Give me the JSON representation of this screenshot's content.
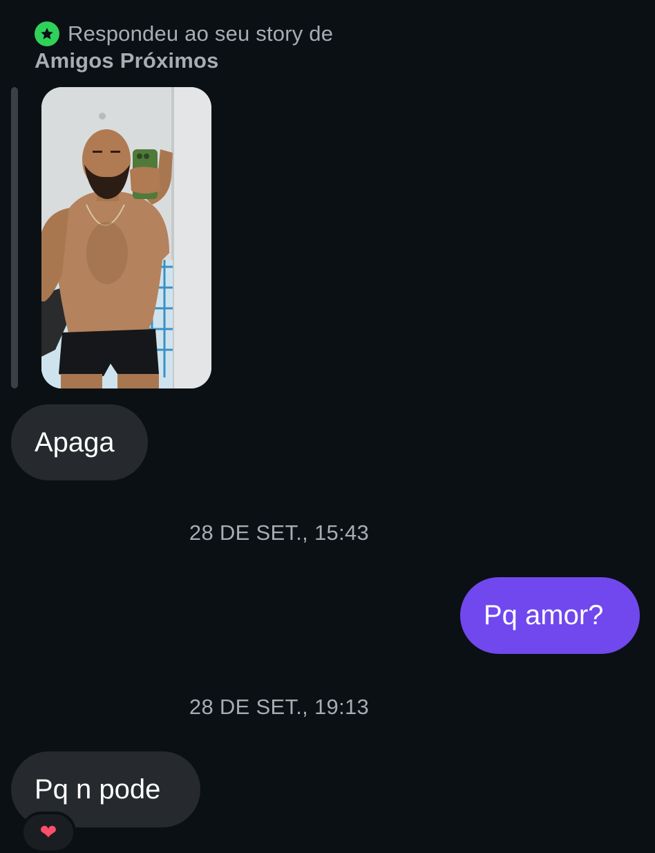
{
  "story_reply": {
    "label": "Respondeu ao seu story de",
    "list_name": "Amigos Próximos",
    "badge_icon": "close-friends-star-icon",
    "badge_color": "#2fd15a"
  },
  "messages": [
    {
      "direction": "incoming",
      "text": "Apaga"
    },
    {
      "direction": "outgoing",
      "text": "Pq amor?"
    },
    {
      "direction": "incoming",
      "text": "Pq n pode",
      "reaction": "❤"
    }
  ],
  "timestamps": [
    "28 DE SET., 15:43",
    "28 DE SET., 19:13"
  ],
  "colors": {
    "background": "#0b1014",
    "incoming_bubble": "#262a2e",
    "outgoing_bubble": "#7048ee",
    "muted_text": "#a8adb3"
  }
}
